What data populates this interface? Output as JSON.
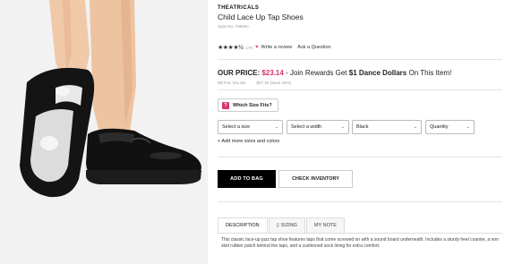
{
  "product": {
    "brand": "THEATRICALS",
    "title": "Child Lace Up Tap Shoes",
    "style_no": "Style No. T9600C",
    "rating": {
      "stars": "★★★★½",
      "count": "170",
      "write_review": "Write a review",
      "ask_question": "Ask a Question"
    },
    "price": {
      "label": "OUR PRICE:",
      "value": "$23.14",
      "join_text": "- Join Rewards Get",
      "dance_dollars": "$1 Dance Dollars",
      "tail_text": "On This Item!"
    },
    "retail": {
      "label": "RETAIL VALUE:",
      "amount": "$27.20 (Save 15%)"
    },
    "size_fit_label": "Which Size Fits?",
    "selects": [
      {
        "value": "Select a size"
      },
      {
        "value": "Select a width"
      },
      {
        "value": "Black"
      },
      {
        "value": "Quantity"
      }
    ],
    "add_more": "+ Add more sizes and colors",
    "add_to_bag": "ADD TO BAG",
    "check_inventory": "CHECK INVENTORY",
    "tabs": [
      {
        "label": "DESCRIPTION",
        "active": true
      },
      {
        "label": "SIZING",
        "active": false
      },
      {
        "label": "MY NOTE",
        "active": false
      }
    ],
    "description": "This classic lace-up jazz tap shoe features taps that come screwed on with a sound board underneath. Includes a sturdy heel counter, a non skid rubber patch behind the taps, and a cushioned sock lining for extra comfort."
  },
  "colors": {
    "accent": "#d6336c",
    "button_dark": "#000000"
  },
  "icons": {
    "heart": "heart-icon",
    "size_fit": "ruler-icon",
    "chevron": "chevron-down-icon"
  }
}
